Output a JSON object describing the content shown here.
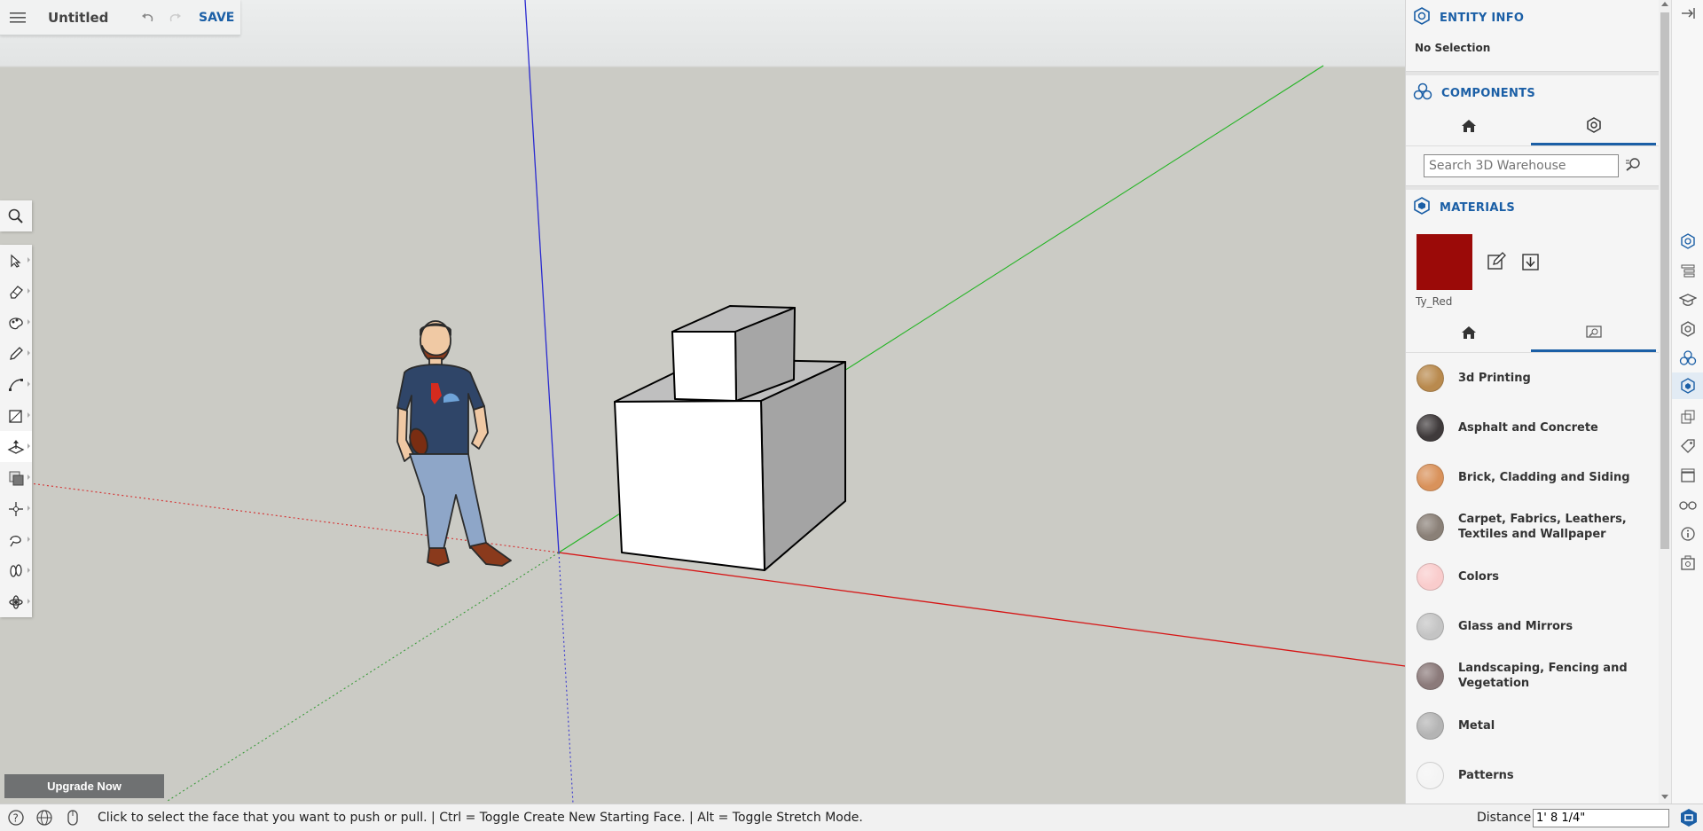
{
  "titlebar": {
    "title": "Untitled",
    "save_label": "SAVE"
  },
  "entity_info": {
    "title": "ENTITY INFO",
    "selection": "No Selection"
  },
  "components": {
    "title": "COMPONENTS",
    "search_placeholder": "Search 3D Warehouse"
  },
  "materials": {
    "title": "MATERIALS",
    "current": {
      "name": "Ty_Red",
      "color": "#9b0a08"
    },
    "items": [
      {
        "label": "3d Printing",
        "color": "#b98a4e"
      },
      {
        "label": "Asphalt and Concrete",
        "color": "#3f3a3b"
      },
      {
        "label": "Brick, Cladding and Siding",
        "color": "#d9925b"
      },
      {
        "label": "Carpet, Fabrics, Leathers, Textiles and Wallpaper",
        "color": "#8a8077"
      },
      {
        "label": "Colors",
        "color": "#f9cccc"
      },
      {
        "label": "Glass and Mirrors",
        "color": "#c4c4c4"
      },
      {
        "label": "Landscaping, Fencing and Vegetation",
        "color": "#8b7a7a"
      },
      {
        "label": "Metal",
        "color": "#b4b4b4"
      },
      {
        "label": "Patterns",
        "color": "#f4f4f4"
      }
    ]
  },
  "upgrade": {
    "label": "Upgrade Now"
  },
  "statusbar": {
    "message": "Click to select the face that you want to push or pull. | Ctrl = Toggle Create New Starting Face. | Alt = Toggle Stretch Mode.",
    "distance_label": "Distance",
    "distance_value": "1' 8 1/4\""
  },
  "colors": {
    "accent": "#1b5fa6",
    "axis_red": "#e01010",
    "axis_green": "#19b519",
    "axis_blue": "#1a1ad0"
  },
  "icons": [
    "menu-icon",
    "undo-icon",
    "redo-icon",
    "search-icon",
    "select-icon",
    "eraser-icon",
    "paint-icon",
    "pencil-icon",
    "arc-icon",
    "rectangle-icon",
    "push-pull-icon",
    "offset-icon",
    "move-icon",
    "tape-measure-icon",
    "walk-icon",
    "orbit-icon"
  ]
}
